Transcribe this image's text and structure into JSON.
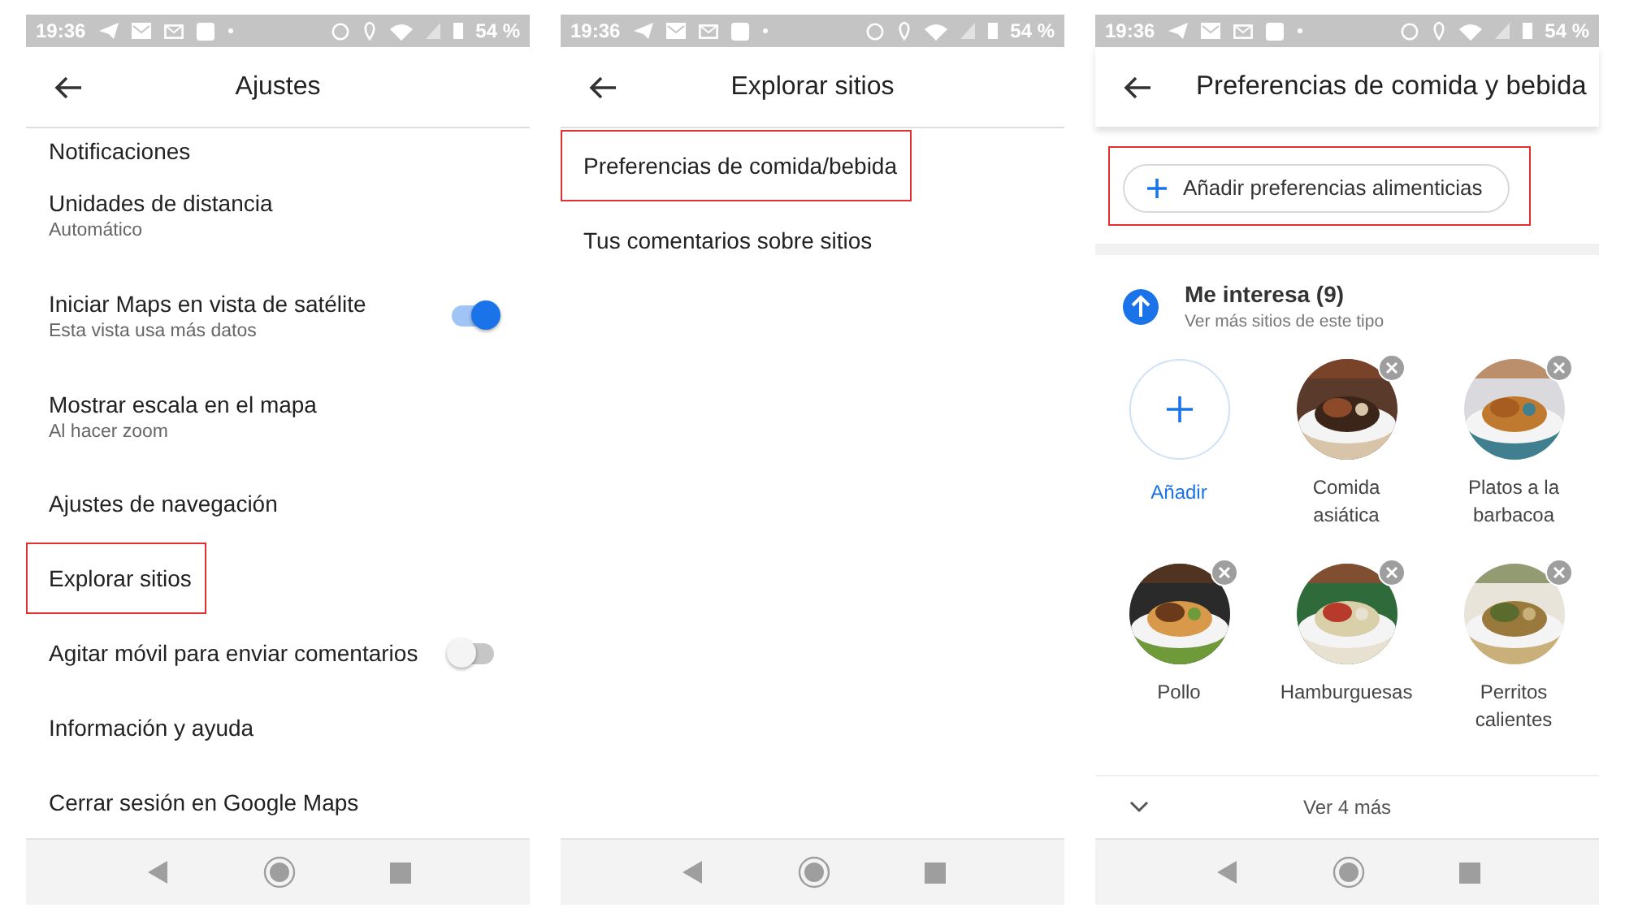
{
  "screens": [
    {
      "kind": "list",
      "time": "19:36",
      "battery": "54 %",
      "title": "Ajustes",
      "items": [
        {
          "kind": "partial",
          "label": "Notificaciones",
          "highlighted": false
        },
        {
          "kind": "row",
          "label": "Unidades de distancia",
          "sublabel": "Automático",
          "highlighted": false
        },
        {
          "kind": "row",
          "label": "Iniciar Maps en vista de satélite",
          "sublabel": "Esta vista usa más datos",
          "toggle": {
            "on": true
          },
          "highlighted": false
        },
        {
          "kind": "row",
          "label": "Mostrar escala en el mapa",
          "sublabel": "Al hacer zoom",
          "highlighted": false
        },
        {
          "kind": "row",
          "label": "Ajustes de navegación",
          "highlighted": false
        },
        {
          "kind": "row",
          "label": "Explorar sitios",
          "highlighted": true
        },
        {
          "kind": "row",
          "label": "Agitar móvil para enviar comentarios",
          "toggle": {
            "on": false
          },
          "highlighted": false
        },
        {
          "kind": "row",
          "label": "Información y ayuda",
          "highlighted": false
        },
        {
          "kind": "row",
          "label": "Cerrar sesión en Google Maps",
          "highlighted": false
        }
      ]
    },
    {
      "kind": "list",
      "time": "19:36",
      "battery": "54 %",
      "title": "Explorar sitios",
      "items": [
        {
          "kind": "row",
          "label": "Preferencias de comida/bebida",
          "highlighted": true
        },
        {
          "kind": "row",
          "label": "Tus comentarios sobre sitios",
          "highlighted": false
        }
      ]
    },
    {
      "kind": "food",
      "time": "19:36",
      "battery": "54 %",
      "title": "Preferencias de comida y bebida",
      "add_button": {
        "label": "Añadir preferencias alimenticias",
        "highlighted": true
      },
      "section": {
        "title": "Me interesa (9)",
        "subtitle": "Ver más sitios de este tipo"
      },
      "tiles": [
        {
          "kind": "add",
          "label": "Añadir"
        },
        {
          "kind": "food",
          "label": "Comida\nasiática"
        },
        {
          "kind": "food",
          "label": "Platos a la\nbarbacoa"
        },
        {
          "kind": "food",
          "label": "Pollo"
        },
        {
          "kind": "food",
          "label": "Hamburguesas"
        },
        {
          "kind": "food",
          "label": "Perritos\ncalientes"
        }
      ],
      "more": "Ver 4 más"
    }
  ]
}
